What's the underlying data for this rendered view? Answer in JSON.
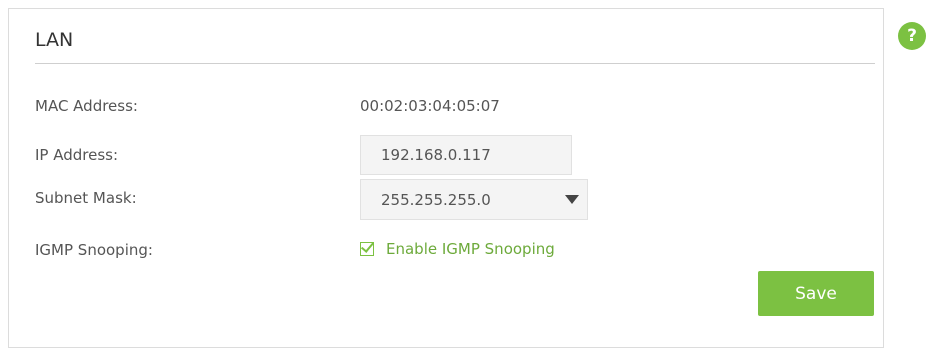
{
  "section": {
    "title": "LAN"
  },
  "help": {
    "icon": "question-icon",
    "glyph": "?"
  },
  "fields": {
    "mac_address": {
      "label": "MAC Address:",
      "value": "00:02:03:04:05:07"
    },
    "ip_address": {
      "label": "IP Address:",
      "value": "192.168.0.117"
    },
    "subnet_mask": {
      "label": "Subnet Mask:",
      "selected": "255.255.255.0"
    },
    "igmp_snooping": {
      "label": "IGMP Snooping:",
      "checkbox_label": "Enable IGMP Snooping",
      "checked": true
    }
  },
  "actions": {
    "save_label": "Save"
  },
  "colors": {
    "accent": "#7cc142",
    "checkbox_text": "#6daa3b",
    "label_text": "#555555",
    "field_background": "#f4f4f4"
  }
}
